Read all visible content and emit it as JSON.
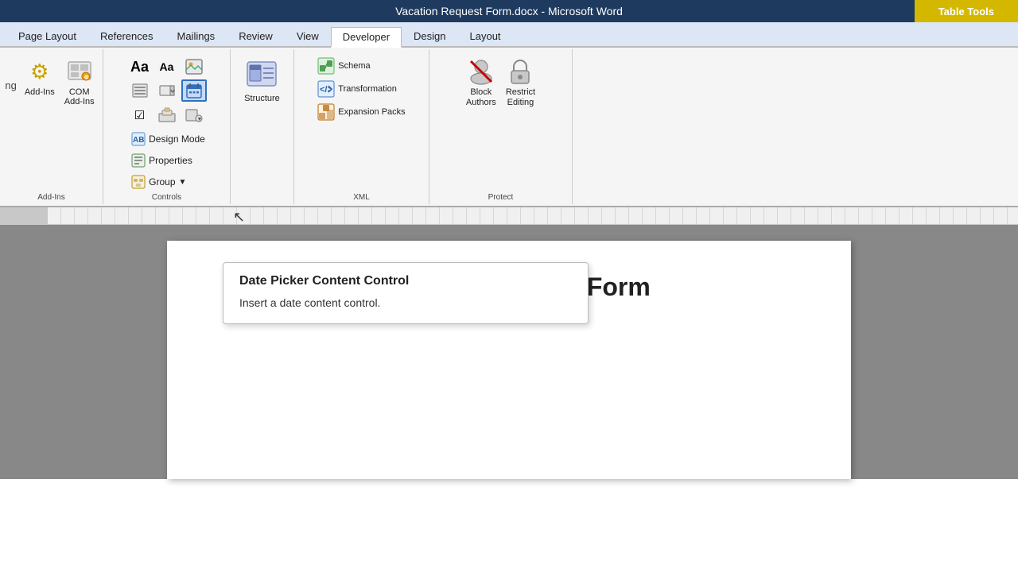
{
  "titleBar": {
    "title": "Vacation Request Form.docx - Microsoft Word",
    "tableTools": "Table Tools"
  },
  "tabs": [
    {
      "label": "Page Layout",
      "active": false
    },
    {
      "label": "References",
      "active": false
    },
    {
      "label": "Mailings",
      "active": false
    },
    {
      "label": "Review",
      "active": false
    },
    {
      "label": "View",
      "active": false
    },
    {
      "label": "Developer",
      "active": true
    },
    {
      "label": "Design",
      "active": false
    },
    {
      "label": "Layout",
      "active": false
    }
  ],
  "ribbon": {
    "addIns": {
      "label": "Add-Ins",
      "addInsBtn": "Add-Ins",
      "comAddInsBtn": "COM\nAdd-Ins"
    },
    "controls": {
      "label": "Controls",
      "designMode": "Design Mode",
      "properties": "Properties",
      "group": "Group"
    },
    "structure": {
      "label": "",
      "structureBtn": "Structure"
    },
    "xml": {
      "label": "XML",
      "schemaBtn": "Schema",
      "transformationBtn": "Transformation",
      "expansionPacksBtn": "Expansion Packs"
    },
    "protect": {
      "label": "Protect",
      "blockAuthors": "Block\nAuthors",
      "restrictEditing": "Restrict\nEditing"
    }
  },
  "tooltip": {
    "title": "Date Picker Content Control",
    "description": "Insert a date content control."
  },
  "document": {
    "heading": "Vacation Request Form"
  }
}
